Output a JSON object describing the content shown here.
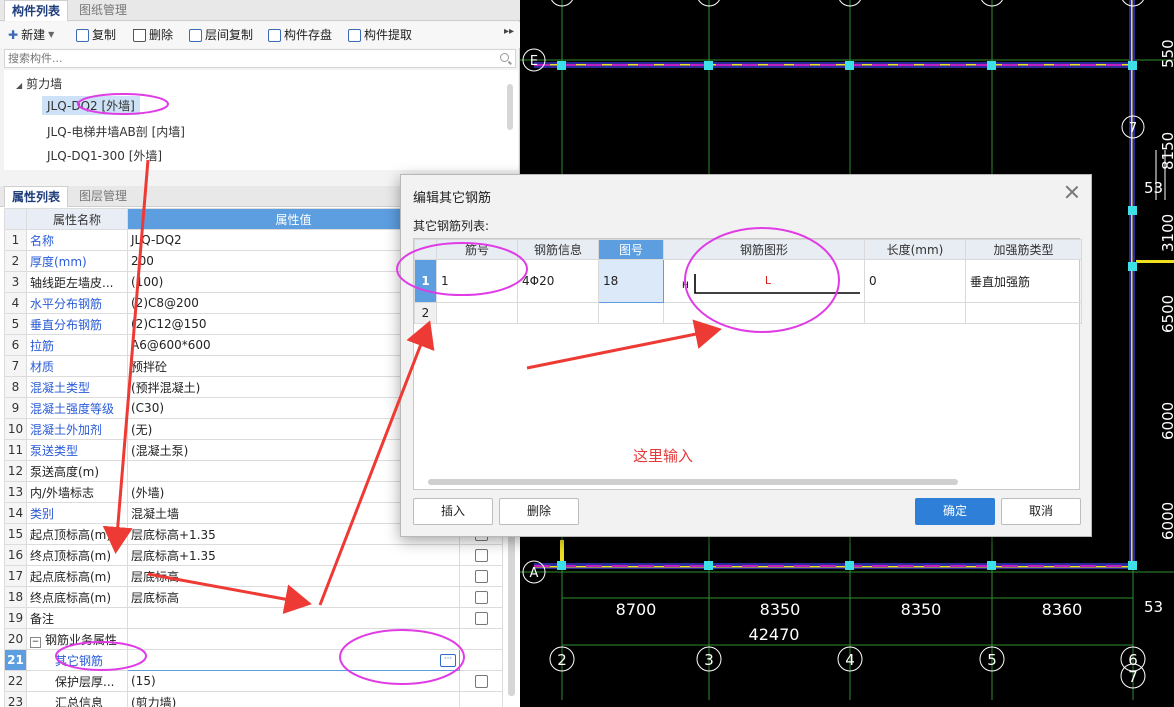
{
  "component_panel": {
    "tabs": [
      {
        "label": "构件列表"
      },
      {
        "label": "图纸管理"
      }
    ],
    "toolbar": {
      "new_label": "新建",
      "copy_label": "复制",
      "delete_label": "删除",
      "floor_copy_label": "层间复制",
      "save_label": "构件存盘",
      "extract_label": "构件提取",
      "more_symbol": "▸▸"
    },
    "search_placeholder": "搜索构件...",
    "tree": {
      "category": "剪力墙",
      "items": [
        {
          "label": "JLQ-DQ2 [外墙]"
        },
        {
          "label": "JLQ-电梯井墙AB剖 [内墙]"
        },
        {
          "label": "JLQ-DQ1-300 [外墙]"
        }
      ]
    }
  },
  "property_panel": {
    "tabs": [
      {
        "label": "属性列表"
      },
      {
        "label": "图层管理"
      }
    ],
    "header": {
      "name": "属性名称",
      "value": "属性值"
    },
    "rows": [
      {
        "num": "1",
        "name": "名称",
        "value": "JLQ-DQ2"
      },
      {
        "num": "2",
        "name": "厚度(mm)",
        "value": "200"
      },
      {
        "num": "3",
        "name": "轴线距左墙皮...",
        "value": "(100)"
      },
      {
        "num": "4",
        "name": "水平分布钢筋",
        "value": "(2)C8@200"
      },
      {
        "num": "5",
        "name": "垂直分布钢筋",
        "value": "(2)C12@150"
      },
      {
        "num": "6",
        "name": "拉筋",
        "value": "A6@600*600"
      },
      {
        "num": "7",
        "name": "材质",
        "value": "预拌砼"
      },
      {
        "num": "8",
        "name": "混凝土类型",
        "value": "(预拌混凝土)"
      },
      {
        "num": "9",
        "name": "混凝土强度等级",
        "value": "(C30)"
      },
      {
        "num": "10",
        "name": "混凝土外加剂",
        "value": "(无)"
      },
      {
        "num": "11",
        "name": "泵送类型",
        "value": "(混凝土泵)"
      },
      {
        "num": "12",
        "name": "泵送高度(m)",
        "value": ""
      },
      {
        "num": "13",
        "name": "内/外墙标志",
        "value": "(外墙)"
      },
      {
        "num": "14",
        "name": "类别",
        "value": "混凝土墙"
      },
      {
        "num": "15",
        "name": "起点顶标高(m)",
        "value": "层底标高+1.35"
      },
      {
        "num": "16",
        "name": "终点顶标高(m)",
        "value": "层底标高+1.35"
      },
      {
        "num": "17",
        "name": "起点底标高(m)",
        "value": "层底标高"
      },
      {
        "num": "18",
        "name": "终点底标高(m)",
        "value": "层底标高"
      },
      {
        "num": "19",
        "name": "备注",
        "value": ""
      },
      {
        "num": "20",
        "name": "钢筋业务属性",
        "value": ""
      },
      {
        "num": "21",
        "name": "其它钢筋",
        "value": ""
      },
      {
        "num": "22",
        "name": "保护层厚...",
        "value": "(15)"
      },
      {
        "num": "23",
        "name": "汇总信息",
        "value": "(剪力墙)"
      }
    ],
    "edit_button_symbol": "···",
    "group_toggle_symbol": "−"
  },
  "dialog": {
    "title": "编辑其它钢筋",
    "subtitle": "其它钢筋列表:",
    "columns": [
      "筋号",
      "钢筋信息",
      "图号",
      "钢筋图形",
      "长度(mm)",
      "加强筋类型"
    ],
    "rows": [
      {
        "num": "1",
        "bar_no": "1",
        "info": "4Φ20",
        "fig_no": "18",
        "shape_label": "L",
        "shape_mark": "H",
        "length": "0",
        "type": "垂直加强筋"
      },
      {
        "num": "2",
        "bar_no": "",
        "info": "",
        "fig_no": "",
        "shape_label": "",
        "shape_mark": "",
        "length": "",
        "type": ""
      }
    ],
    "hint": "这里输入",
    "buttons": {
      "insert": "插入",
      "delete": "删除",
      "ok": "确定",
      "cancel": "取消"
    }
  },
  "cad_view": {
    "axis_bubbles_bottom": [
      "2",
      "3",
      "4",
      "5",
      "6"
    ],
    "axis_bubble_extra": "7",
    "axis_bubbles_left": [
      "E",
      "A"
    ],
    "axis_bubble_right": "7",
    "dimensions_bottom": [
      "8700",
      "8350",
      "8350",
      "8360"
    ],
    "dimension_total": "42470",
    "dimensions_right": [
      "550",
      "8150",
      "3100",
      "6500",
      "6000",
      "6000",
      "53",
      "53"
    ]
  },
  "colors": {
    "accent_blue": "#5c9ee0",
    "annotation_magenta": "#e03ce6",
    "annotation_red": "#ee3a34",
    "cad_background": "#000000"
  }
}
